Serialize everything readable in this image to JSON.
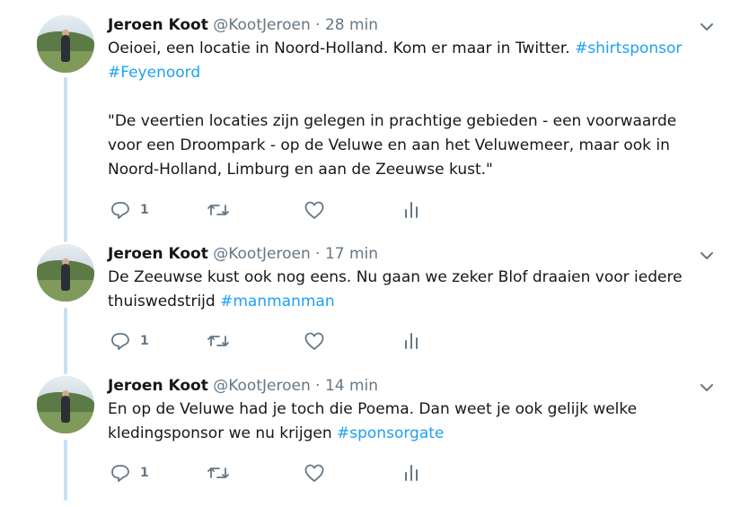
{
  "tweets": [
    {
      "name": "Jeroen Koot",
      "handle": "@KootJeroen",
      "separator": "·",
      "time": "28 min",
      "line1_text": "Oeioei, een locatie in Noord-Holland. Kom er maar in Twitter. ",
      "line1_tag": "#shirtsponsor",
      "line2_tag": "#Feyenoord",
      "quote": "\"De veertien locaties zijn gelegen in prachtige gebieden - een voorwaarde voor een Droompark - op de Veluwe en aan het Veluwemeer, maar ook in Noord-Holland, Limburg en aan de Zeeuwse kust.\"",
      "reply_count": "1"
    },
    {
      "name": "Jeroen Koot",
      "handle": "@KootJeroen",
      "separator": "·",
      "time": "17 min",
      "text": "De Zeeuwse kust ook nog eens. Nu gaan we zeker Blof draaien voor iedere thuiswedstrijd ",
      "tag": "#manmanman",
      "reply_count": "1"
    },
    {
      "name": "Jeroen Koot",
      "handle": "@KootJeroen",
      "separator": "·",
      "time": "14 min",
      "text": "En op de Veluwe had je toch die Poema. Dan weet je ook gelijk welke kledingsponsor we nu krijgen ",
      "tag": "#sponsorgate",
      "reply_count": "1"
    }
  ],
  "colors": {
    "hashtag": "#1da1f2",
    "thread_line": "#c4e1f6",
    "secondary_text": "#657786",
    "icon": "#657786"
  },
  "icons": [
    "chevron-down-icon",
    "reply-icon",
    "retweet-icon",
    "like-icon",
    "analytics-icon"
  ]
}
